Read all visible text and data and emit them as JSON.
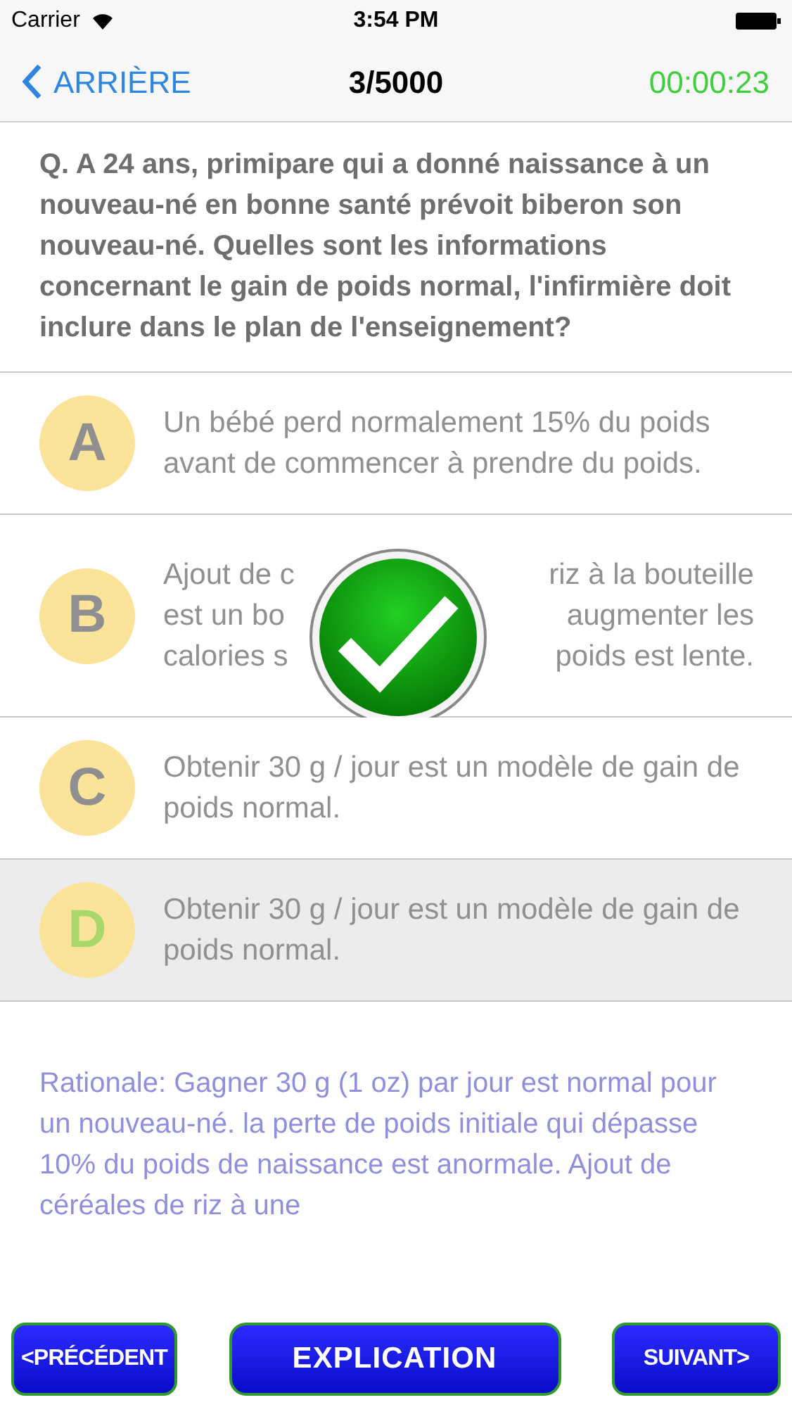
{
  "status_bar": {
    "carrier": "Carrier",
    "time": "3:54 PM"
  },
  "nav": {
    "back": "ARRIÈRE",
    "counter": "3/5000",
    "timer": "00:00:23"
  },
  "question": "Q. A 24 ans, primipare qui a donné naissance à un nouveau-né en bonne santé prévoit biberon son nouveau-né. Quelles sont les informations concernant le gain de poids normal, l'infirmière doit inclure dans le plan de l'enseignement?",
  "options": [
    {
      "letter": "A",
      "selected": false,
      "correct": false,
      "text": "Un bébé perd normalement 15% du poids avant de commencer à prendre du poids."
    },
    {
      "letter": "B",
      "selected": false,
      "correct": true,
      "fragments": [
        [
          "Ajout de c",
          "riz à la bouteille"
        ],
        [
          "est un bo",
          "augmenter les"
        ],
        [
          "calories s",
          "poids est lente."
        ]
      ]
    },
    {
      "letter": "C",
      "selected": false,
      "correct": false,
      "text": "Obtenir 30 g / jour est un modèle de gain de poids normal."
    },
    {
      "letter": "D",
      "selected": true,
      "correct": false,
      "text": "Obtenir 30 g / jour est un modèle de gain de poids normal."
    }
  ],
  "rationale": "Rationale: Gagner 30 g (1 oz) par jour est normal pour un nouveau-né. la perte de poids initiale qui dépasse 10% du poids de naissance est anormale. Ajout de céréales de riz à une",
  "buttons": {
    "previous": "<PRÉCÉDENT",
    "explanation": "EXPLICATION",
    "next": "SUIVANT>"
  }
}
